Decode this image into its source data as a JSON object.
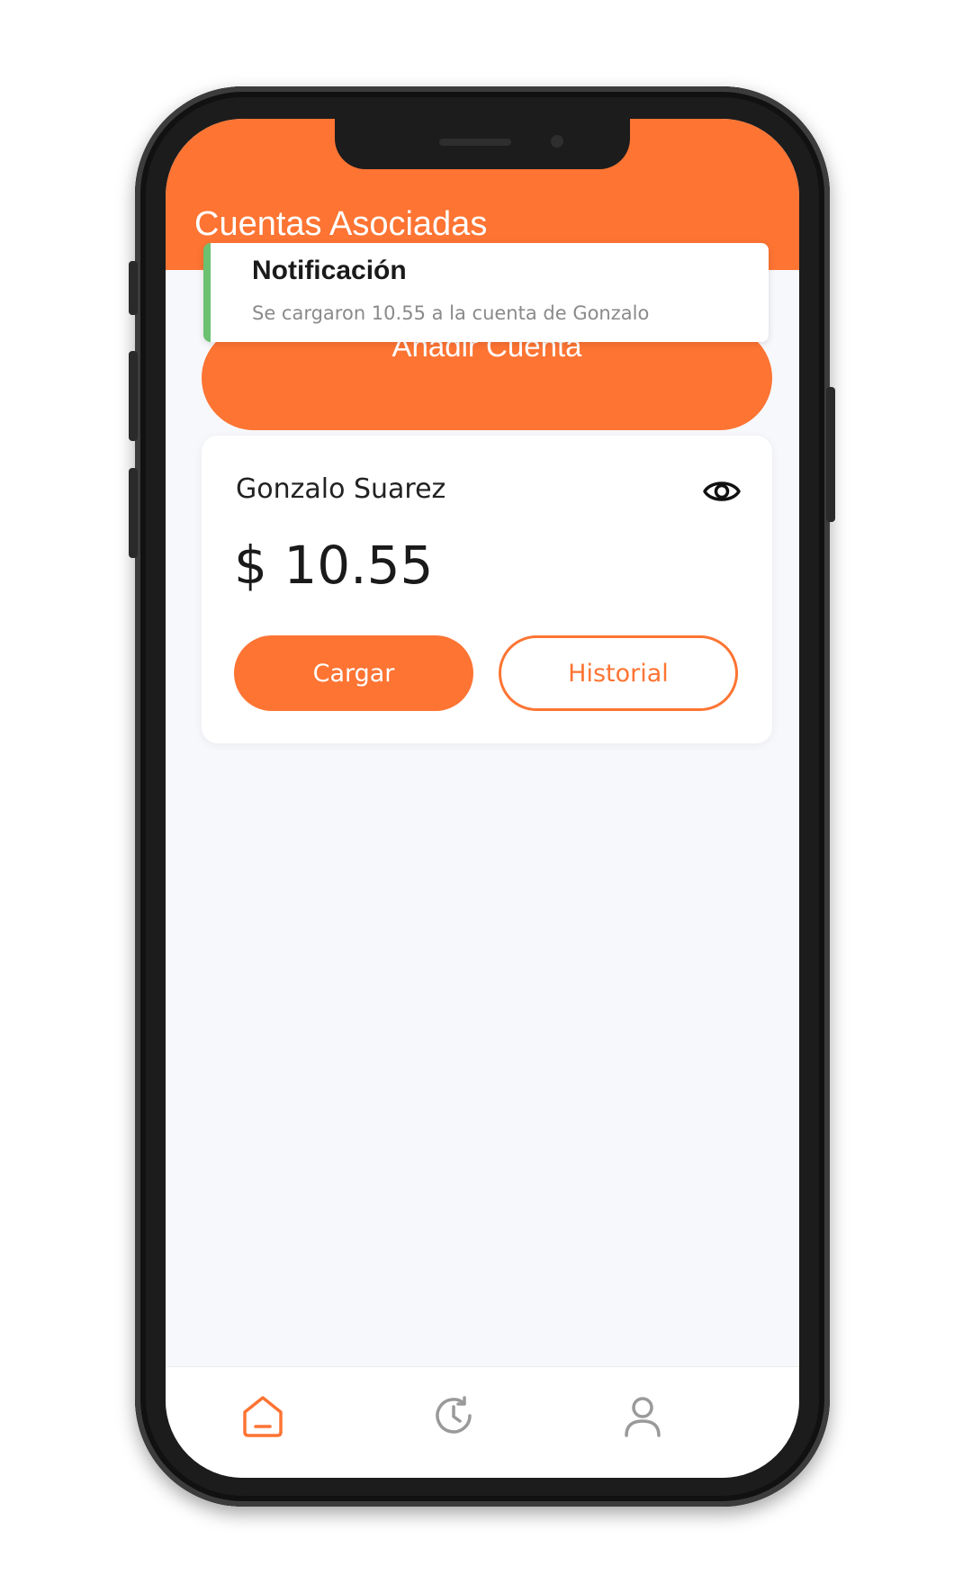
{
  "header": {
    "title": "Cuentas Asociadas"
  },
  "notification": {
    "title": "Notificación",
    "message": "Se cargaron 10.55 a la cuenta de Gonzalo",
    "accent_color": "#6cc071"
  },
  "add_account": {
    "label": "Añadir Cuenta"
  },
  "account": {
    "holder": "Gonzalo Suarez",
    "balance": "$ 10.55",
    "visibility_icon": "eye-icon",
    "load_label": "Cargar",
    "history_label": "Historial"
  },
  "bottom_nav": {
    "items": [
      {
        "icon": "home-icon",
        "active": true
      },
      {
        "icon": "history-icon",
        "active": false
      },
      {
        "icon": "profile-icon",
        "active": false
      }
    ]
  },
  "colors": {
    "brand": "#fd7433",
    "background": "#f7f8fb",
    "inactive_icon": "#9a9a9a"
  }
}
